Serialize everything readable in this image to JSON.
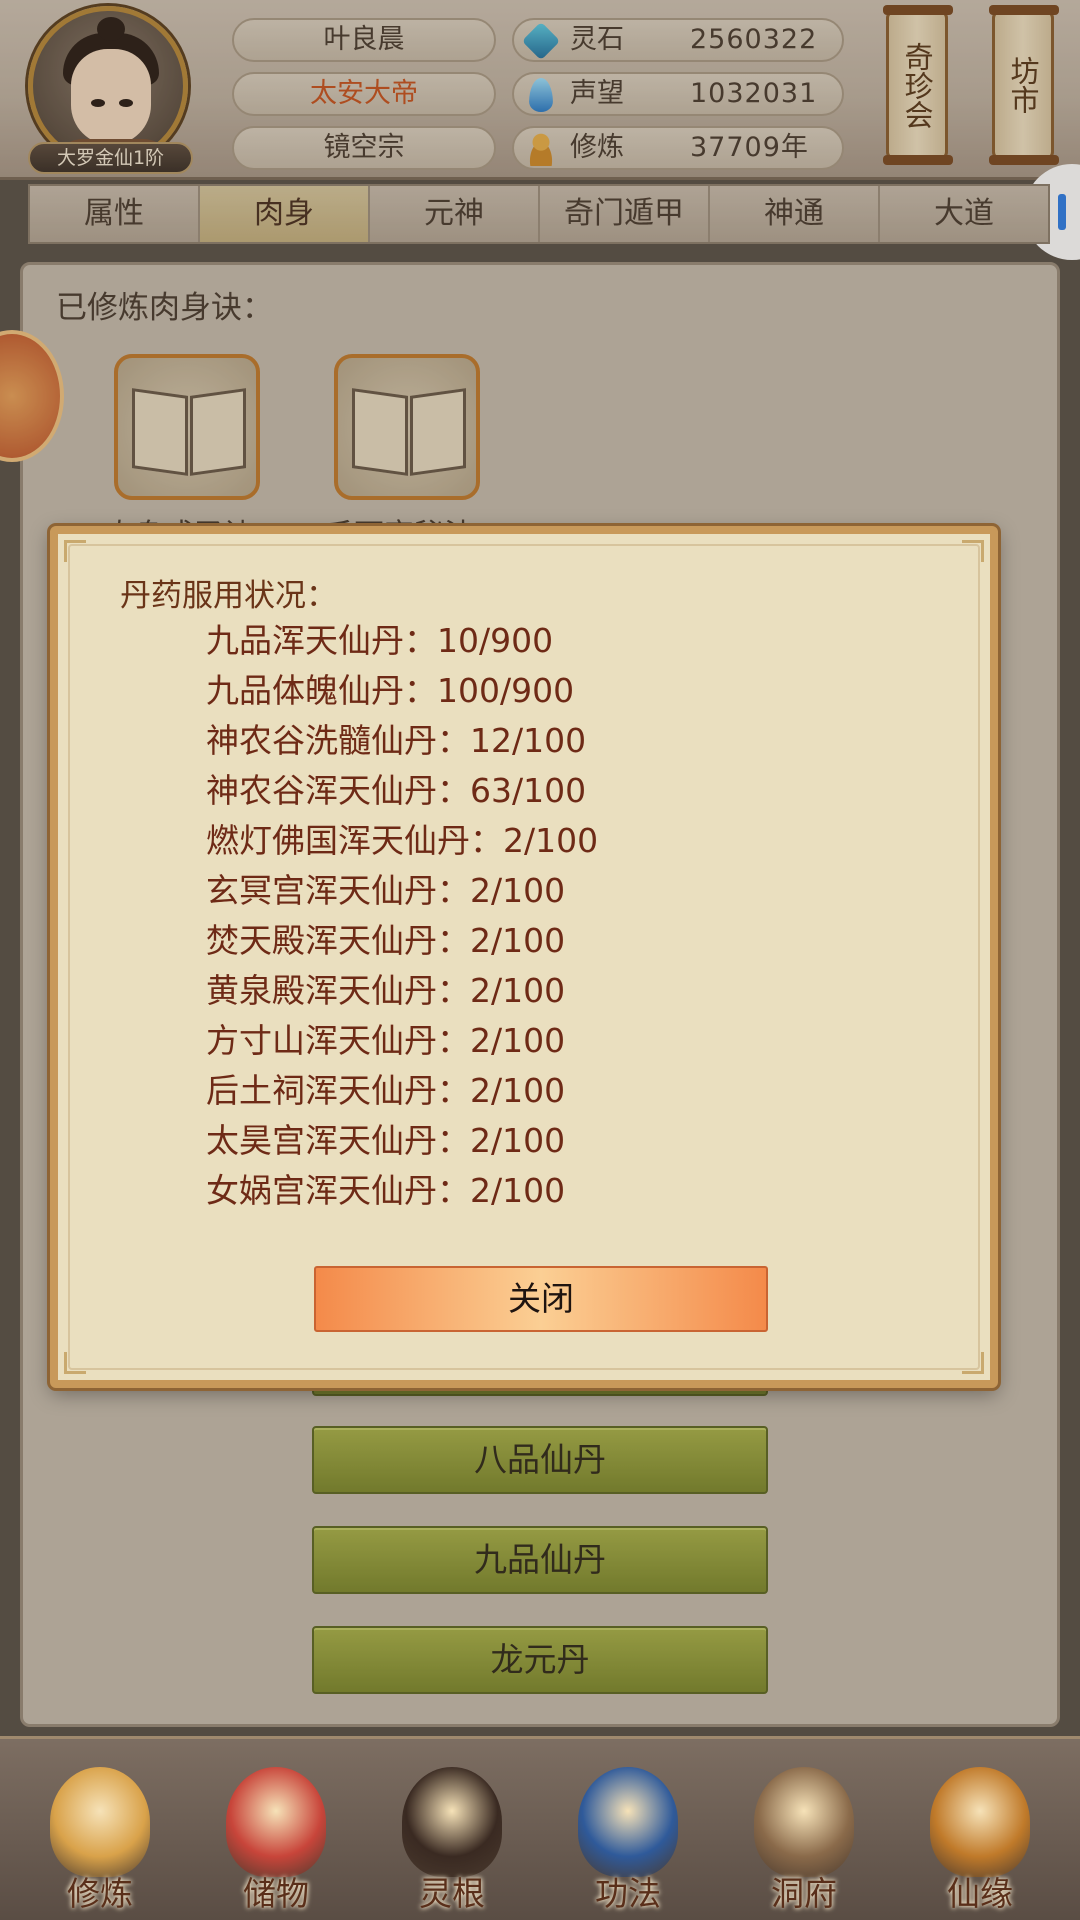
{
  "player": {
    "rank": "大罗金仙1阶",
    "name": "叶良晨",
    "title": "太安大帝",
    "sect": "镜空宗"
  },
  "resources": [
    {
      "icon": "spirit-stone-icon",
      "label": "灵石",
      "value": "2560322"
    },
    {
      "icon": "prestige-icon",
      "label": "声望",
      "value": "1032031"
    },
    {
      "icon": "cultivation-icon",
      "label": "修炼",
      "value": "37709年"
    }
  ],
  "shops": {
    "treasure_fair": "奇珍会",
    "market": "坊市"
  },
  "tabs": [
    "属性",
    "肉身",
    "元神",
    "奇门遁甲",
    "神通",
    "大道"
  ],
  "active_tab": "肉身",
  "body_panel": {
    "practiced_label": "已修炼肉身诀：",
    "books": [
      "肉身成圣诀",
      "千面宗秘法"
    ]
  },
  "background_buttons": [
    "八品仙丹",
    "九品仙丹",
    "龙元丹"
  ],
  "modal": {
    "title": "丹药服用状况：",
    "pills": [
      {
        "name": "九品浑天仙丹",
        "value": "10/900"
      },
      {
        "name": "九品体魄仙丹",
        "value": "100/900"
      },
      {
        "name": "神农谷洗髓仙丹",
        "value": "12/100"
      },
      {
        "name": "神农谷浑天仙丹",
        "value": "63/100"
      },
      {
        "name": "燃灯佛国浑天仙丹",
        "value": "2/100"
      },
      {
        "name": "玄冥宫浑天仙丹",
        "value": "2/100"
      },
      {
        "name": "焚天殿浑天仙丹",
        "value": "2/100"
      },
      {
        "name": "黄泉殿浑天仙丹",
        "value": "2/100"
      },
      {
        "name": "方寸山浑天仙丹",
        "value": "2/100"
      },
      {
        "name": "后土祠浑天仙丹",
        "value": "2/100"
      },
      {
        "name": "太昊宫浑天仙丹",
        "value": "2/100"
      },
      {
        "name": "女娲宫浑天仙丹",
        "value": "2/100"
      }
    ],
    "separator": "：",
    "close_label": "关闭"
  },
  "bottom_nav": [
    {
      "label": "修炼",
      "icon": "meditating-monk-icon",
      "color": "#d9a24a"
    },
    {
      "label": "储物",
      "icon": "storage-bag-icon",
      "color": "#c8453a"
    },
    {
      "label": "灵根",
      "icon": "spirit-root-icon",
      "color": "#3a2a22"
    },
    {
      "label": "功法",
      "icon": "technique-book-icon",
      "color": "#2f5a9a"
    },
    {
      "label": "洞府",
      "icon": "cave-palace-icon",
      "color": "#8a6a4a"
    },
    {
      "label": "仙缘",
      "icon": "gourd-icon",
      "color": "#c07a2a"
    }
  ]
}
